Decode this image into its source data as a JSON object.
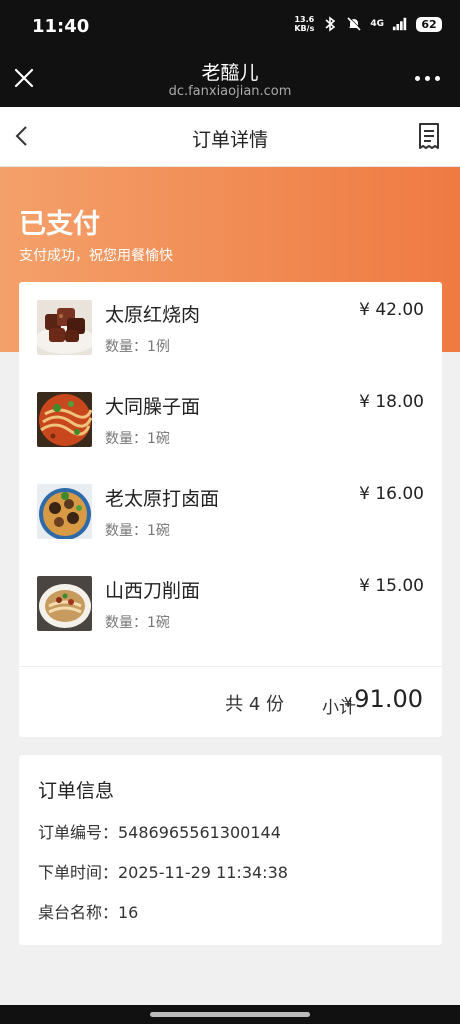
{
  "status_bar": {
    "time": "11:40",
    "net_speed_value": "13.6",
    "net_speed_unit": "KB/s",
    "network": "4G",
    "battery": "62"
  },
  "browser": {
    "title": "老醯儿",
    "url": "dc.fanxiaojian.com"
  },
  "page": {
    "title": "订单详情"
  },
  "status": {
    "title": "已支付",
    "subtitle": "支付成功，祝您用餐愉快"
  },
  "items": [
    {
      "name": "太原红烧肉",
      "qty": "数量：1例",
      "price": "¥ 42.00"
    },
    {
      "name": "大同臊子面",
      "qty": "数量：1碗",
      "price": "¥ 18.00"
    },
    {
      "name": "老太原打卤面",
      "qty": "数量：1碗",
      "price": "¥ 16.00"
    },
    {
      "name": "山西刀削面",
      "qty": "数量：1碗",
      "price": "¥ 15.00"
    }
  ],
  "summary": {
    "count": "共 4 份",
    "subtotal_label": "小计",
    "currency": "¥",
    "subtotal": "91.00"
  },
  "order_info": {
    "title": "订单信息",
    "order_no": "订单编号：5486965561300144",
    "order_time": "下单时间：2025-11-29 11:34:38",
    "table_name": "桌台名称：16"
  }
}
